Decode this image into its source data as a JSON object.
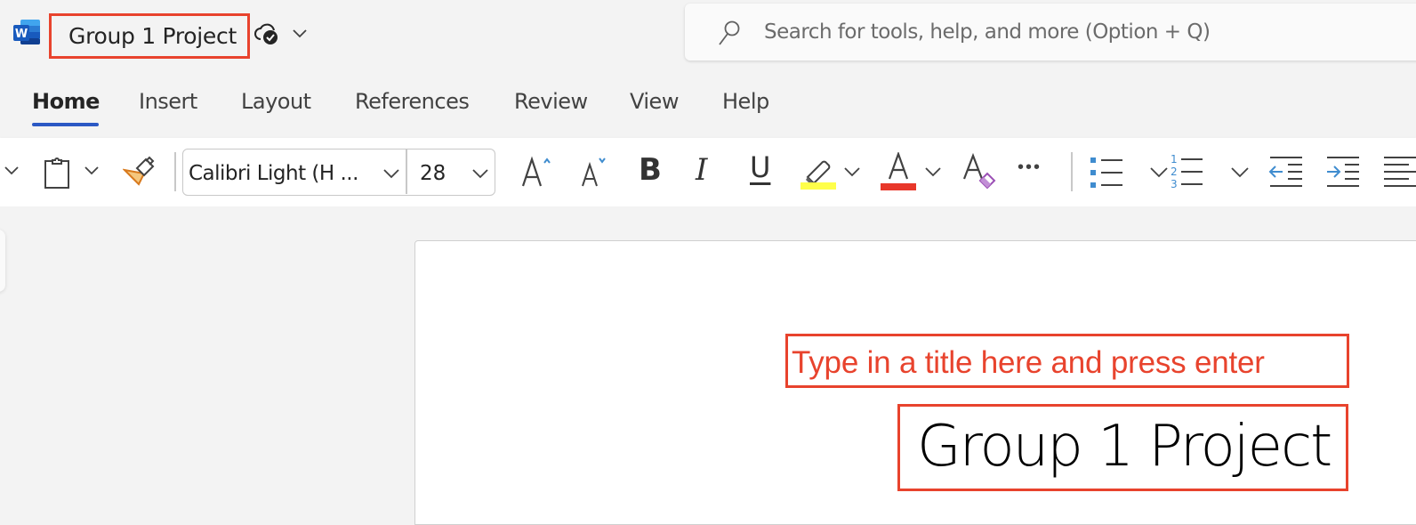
{
  "titlebar": {
    "app_icon": "word-logo-icon",
    "document_title": "Group 1 Project",
    "save_status_icon": "cloud-saved-icon",
    "title_menu_icon": "chevron-down-icon",
    "search": {
      "icon": "search-icon",
      "placeholder": "Search for tools, help, and more (Option + Q)",
      "value": ""
    }
  },
  "tabs": [
    {
      "label": "Home",
      "active": true
    },
    {
      "label": "Insert",
      "active": false
    },
    {
      "label": "Layout",
      "active": false
    },
    {
      "label": "References",
      "active": false
    },
    {
      "label": "Review",
      "active": false
    },
    {
      "label": "View",
      "active": false
    },
    {
      "label": "Help",
      "active": false
    }
  ],
  "ribbon": {
    "font_name": "Calibri Light (H ...",
    "font_size": "28",
    "colors": {
      "highlight": "#ffff4a",
      "font_color": "#e8372a",
      "accent_blue": "#3f8ccf",
      "tab_underline": "#2b58c4"
    },
    "buttons": [
      {
        "name": "undo-dropdown",
        "icon": "chevron-down-icon"
      },
      {
        "name": "paste",
        "icon": "clipboard-icon"
      },
      {
        "name": "paste-options",
        "icon": "chevron-down-icon"
      },
      {
        "name": "format-painter",
        "icon": "paintbrush-icon"
      },
      {
        "name": "increase-font-size",
        "icon": "grow-font-icon"
      },
      {
        "name": "decrease-font-size",
        "icon": "shrink-font-icon"
      },
      {
        "name": "bold",
        "icon": "bold-icon",
        "glyph": "B"
      },
      {
        "name": "italic",
        "icon": "italic-icon",
        "glyph": "I"
      },
      {
        "name": "underline",
        "icon": "underline-icon",
        "glyph": "U"
      },
      {
        "name": "highlight",
        "icon": "highlighter-icon"
      },
      {
        "name": "font-color",
        "icon": "font-color-icon",
        "glyph": "A"
      },
      {
        "name": "clear-formatting",
        "icon": "eraser-icon",
        "glyph": "A"
      },
      {
        "name": "more",
        "icon": "ellipsis-icon",
        "glyph": "•••"
      },
      {
        "name": "bullets",
        "icon": "bulleted-list-icon"
      },
      {
        "name": "numbering",
        "icon": "numbered-list-icon"
      },
      {
        "name": "decrease-indent",
        "icon": "outdent-icon"
      },
      {
        "name": "increase-indent",
        "icon": "indent-icon"
      },
      {
        "name": "align",
        "icon": "align-left-icon"
      }
    ]
  },
  "document": {
    "annotation": "Type in a title here and press enter",
    "heading": "Group 1 Project",
    "annotation_color": "#e8432d"
  }
}
